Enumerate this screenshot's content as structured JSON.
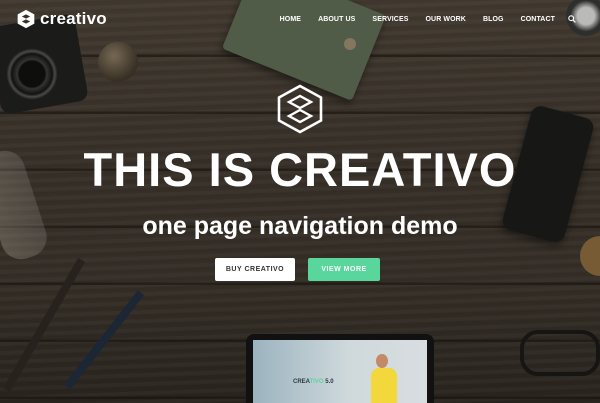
{
  "brand": {
    "name": "creativo",
    "logo_icon": "hexagon-s-logo-icon"
  },
  "nav": {
    "items": [
      {
        "label": "HOME"
      },
      {
        "label": "ABOUT US"
      },
      {
        "label": "SERVICES"
      },
      {
        "label": "OUR WORK"
      },
      {
        "label": "BLOG"
      },
      {
        "label": "CONTACT"
      }
    ],
    "search_icon": "search-icon"
  },
  "hero": {
    "emblem_icon": "hexagon-s-emblem-icon",
    "headline": "THIS IS CREATIVO",
    "subline": "one page navigation demo",
    "buttons": {
      "primary": "BUY CREATIVO",
      "secondary": "VIEW MORE"
    }
  },
  "tablet_preview": {
    "title_main": "CREA",
    "title_accent": "TIVO",
    "title_suffix": "5.0"
  },
  "colors": {
    "accent": "#59d69b",
    "text": "#ffffff",
    "button_white": "#ffffff"
  }
}
